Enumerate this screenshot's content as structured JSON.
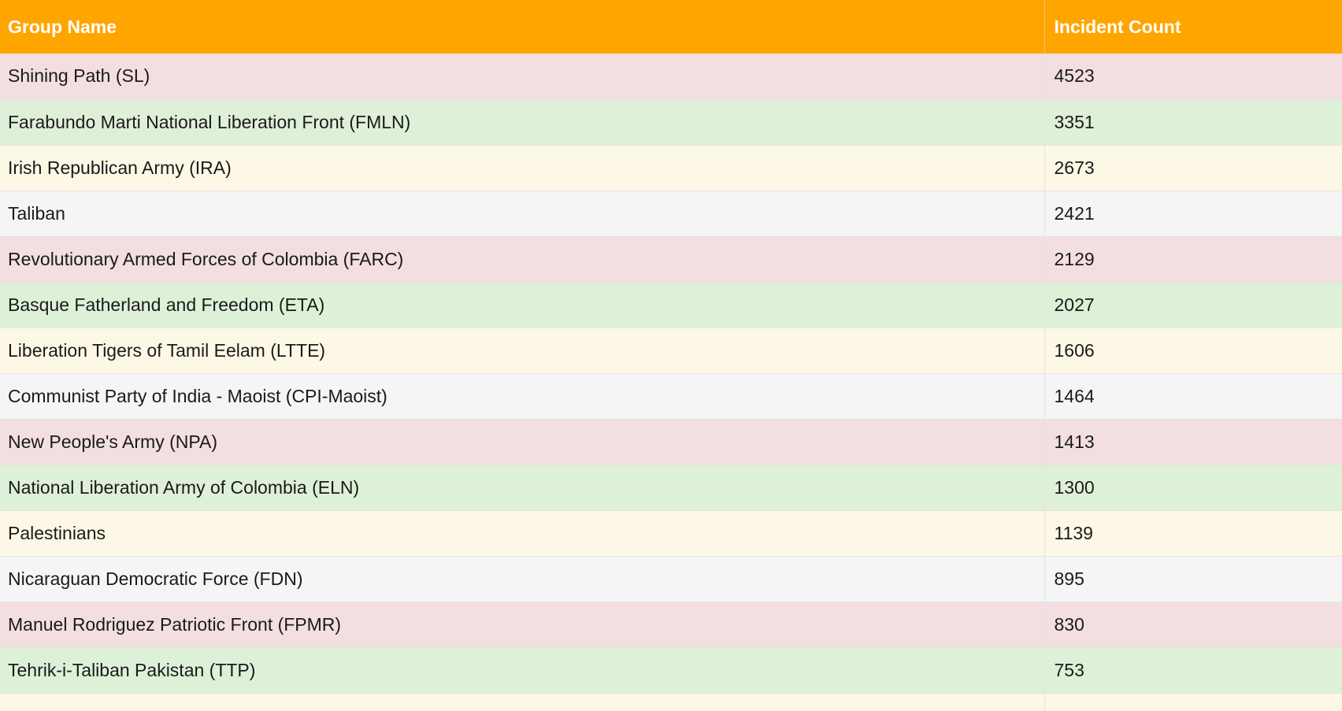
{
  "table": {
    "headers": {
      "group_name": "Group Name",
      "incident_count": "Incident Count"
    },
    "header_color": "#FFA500",
    "row_colors": [
      "#F3DFE0",
      "#DFF0D8",
      "#FDF8E6",
      "#F5F5F5"
    ],
    "rows": [
      {
        "group": "Shining Path (SL)",
        "count": "4523"
      },
      {
        "group": "Farabundo Marti National Liberation Front (FMLN)",
        "count": "3351"
      },
      {
        "group": "Irish Republican Army (IRA)",
        "count": "2673"
      },
      {
        "group": "Taliban",
        "count": "2421"
      },
      {
        "group": "Revolutionary Armed Forces of Colombia (FARC)",
        "count": "2129"
      },
      {
        "group": "Basque Fatherland and Freedom (ETA)",
        "count": "2027"
      },
      {
        "group": "Liberation Tigers of Tamil Eelam (LTTE)",
        "count": "1606"
      },
      {
        "group": "Communist Party of India - Maoist (CPI-Maoist)",
        "count": "1464"
      },
      {
        "group": "New People's Army (NPA)",
        "count": "1413"
      },
      {
        "group": "National Liberation Army of Colombia (ELN)",
        "count": "1300"
      },
      {
        "group": "Palestinians",
        "count": "1139"
      },
      {
        "group": "Nicaraguan Democratic Force (FDN)",
        "count": "895"
      },
      {
        "group": "Manuel Rodriguez Patriotic Front (FPMR)",
        "count": "830"
      },
      {
        "group": "Tehrik-i-Taliban Pakistan (TTP)",
        "count": "753"
      }
    ]
  }
}
